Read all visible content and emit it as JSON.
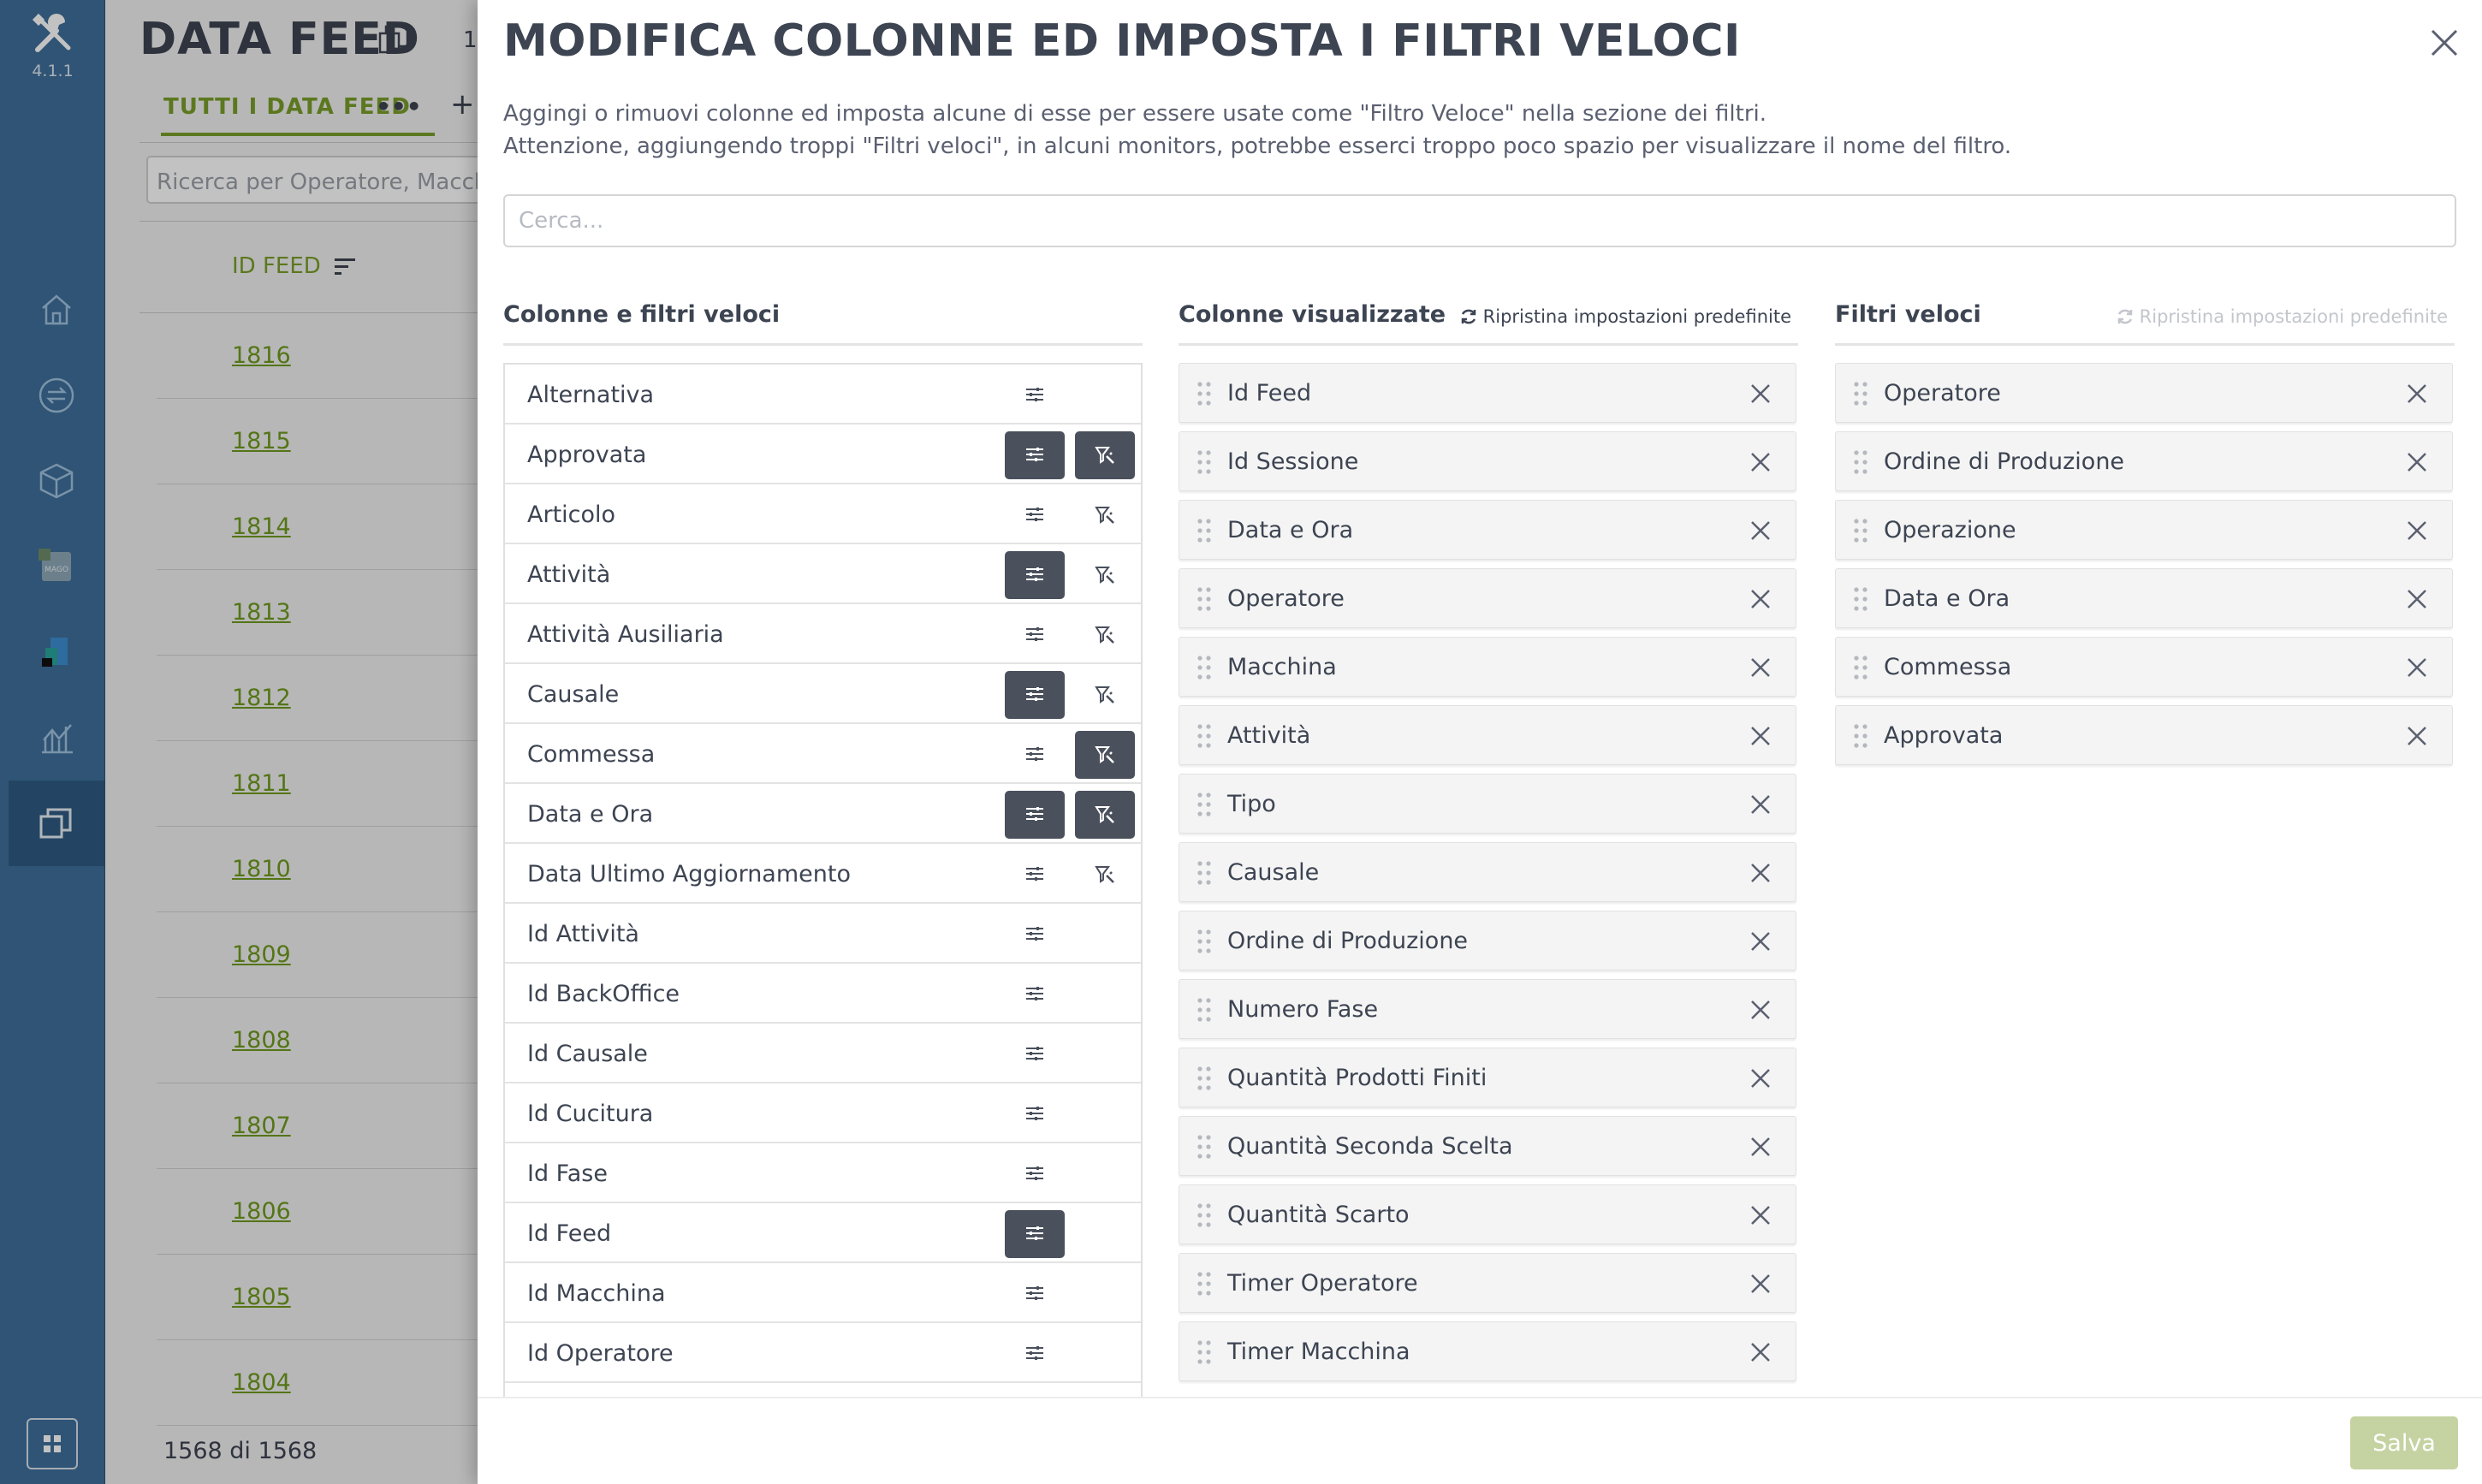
{
  "app": {
    "version": "4.1.1"
  },
  "sidebar": {
    "items": [
      {
        "icon": "home-icon"
      },
      {
        "icon": "swap-icon"
      },
      {
        "icon": "cube-icon"
      },
      {
        "icon": "mago-icon",
        "label": "MAGO"
      },
      {
        "icon": "report-icon"
      },
      {
        "icon": "chart-icon"
      },
      {
        "icon": "datafeed-icon",
        "active": true
      }
    ],
    "bottom_icon": "apps-grid-icon"
  },
  "background_page": {
    "title": "DATA FEED",
    "count_top": "1",
    "tab": "TUTTI I DATA FEED",
    "tab_more": "•••",
    "add": "+",
    "search_placeholder": "Ricerca per Operatore, Macchina",
    "column_header": "ID FEED",
    "rows": [
      "1816",
      "1815",
      "1814",
      "1813",
      "1812",
      "1811",
      "1810",
      "1809",
      "1808",
      "1807",
      "1806",
      "1805",
      "1804"
    ],
    "total": "1568 di 1568"
  },
  "modal": {
    "title": "MODIFICA COLONNE ED IMPOSTA I FILTRI VELOCI",
    "description_1": "Aggingi o rimuovi colonne ed imposta alcune di esse per essere usate come \"Filtro Veloce\" nella sezione dei filtri.",
    "description_2": "Attenzione, aggiungendo troppi \"Filtri veloci\", in alcuni monitors, potrebbe esserci troppo poco spazio per visualizzare il nome del filtro.",
    "search_placeholder": "Cerca...",
    "save_label": "Salva",
    "columns_and_filters": {
      "title": "Colonne e filtri veloci",
      "items": [
        {
          "label": "Alternativa",
          "column": false,
          "filter": null
        },
        {
          "label": "Approvata",
          "column": true,
          "filter": true
        },
        {
          "label": "Articolo",
          "column": false,
          "filter": false
        },
        {
          "label": "Attività",
          "column": true,
          "filter": false
        },
        {
          "label": "Attività Ausiliaria",
          "column": false,
          "filter": false
        },
        {
          "label": "Causale",
          "column": true,
          "filter": false
        },
        {
          "label": "Commessa",
          "column": false,
          "filter": true
        },
        {
          "label": "Data e Ora",
          "column": true,
          "filter": true
        },
        {
          "label": "Data Ultimo Aggiornamento",
          "column": false,
          "filter": false
        },
        {
          "label": "Id Attività",
          "column": false,
          "filter": null
        },
        {
          "label": "Id BackOffice",
          "column": false,
          "filter": null
        },
        {
          "label": "Id Causale",
          "column": false,
          "filter": null
        },
        {
          "label": "Id Cucitura",
          "column": false,
          "filter": null
        },
        {
          "label": "Id Fase",
          "column": false,
          "filter": null
        },
        {
          "label": "Id Feed",
          "column": true,
          "filter": null
        },
        {
          "label": "Id Macchina",
          "column": false,
          "filter": null
        },
        {
          "label": "Id Operatore",
          "column": false,
          "filter": null
        }
      ]
    },
    "visible_columns": {
      "title": "Colonne visualizzate",
      "reset_label": "Ripristina impostazioni predefinite",
      "items": [
        "Id Feed",
        "Id Sessione",
        "Data e Ora",
        "Operatore",
        "Macchina",
        "Attività",
        "Tipo",
        "Causale",
        "Ordine di Produzione",
        "Numero Fase",
        "Quantità Prodotti Finiti",
        "Quantità Seconda Scelta",
        "Quantità Scarto",
        "Timer Operatore",
        "Timer Macchina"
      ]
    },
    "quick_filters": {
      "title": "Filtri veloci",
      "reset_label": "Ripristina impostazioni predefinite",
      "reset_disabled": true,
      "items": [
        "Operatore",
        "Ordine di Produzione",
        "Operazione",
        "Data e Ora",
        "Commessa",
        "Approvata"
      ]
    }
  },
  "colors": {
    "sidebar": "#3f6f9a",
    "accent_green": "#7a9e2a",
    "toggle_on": "#4a505c",
    "save_disabled": "#c5d3a2",
    "text_dark": "#3d4452"
  }
}
